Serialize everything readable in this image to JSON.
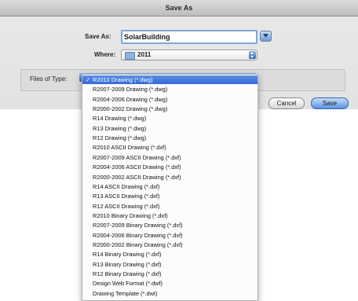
{
  "window": {
    "title": "Save As"
  },
  "save_as": {
    "label": "Save As:",
    "value": "SolarBuilding"
  },
  "where": {
    "label": "Where:",
    "value": "2011",
    "icon": "folder-icon"
  },
  "file_type": {
    "label": "Files of Type:",
    "selected_index": 0,
    "check_mark": "✓",
    "options": [
      "R2010 Drawing (*.dwg)",
      "R2007-2009 Drawing (*.dwg)",
      "R2004-2006 Drawing (*.dwg)",
      "R2000-2002 Drawing (*.dwg)",
      "R14 Drawing (*.dwg)",
      "R13 Drawing (*.dwg)",
      "R12 Drawing (*.dwg)",
      "R2010 ASCII Drawing (*.dxf)",
      "R2007-2009 ASCII Drawing (*.dxf)",
      "R2004-2006 ASCII Drawing (*.dxf)",
      "R2000-2002 ASCII Drawing (*.dxf)",
      "R14 ASCII Drawing (*.dxf)",
      "R13 ASCII Drawing (*.dxf)",
      "R12 ASCII Drawing (*.dxf)",
      "R2010 Binary Drawing (*.dxf)",
      "R2007-2009 Binary Drawing (*.dxf)",
      "R2004-2006 Binary Drawing (*.dxf)",
      "R2000-2002 Binary Drawing (*.dxf)",
      "R14 Binary Drawing (*.dxf)",
      "R13 Binary Drawing (*.dxf)",
      "R12 Binary Drawing (*.dxf)",
      "Design Web Format (*.dwf)",
      "Drawing Template (*.dwt)"
    ]
  },
  "buttons": {
    "cancel": "Cancel",
    "save": "Save"
  },
  "colors": {
    "selection": "#3d72dc",
    "focus_ring": "#7fa6d9",
    "default_button": "#5c93e0"
  }
}
